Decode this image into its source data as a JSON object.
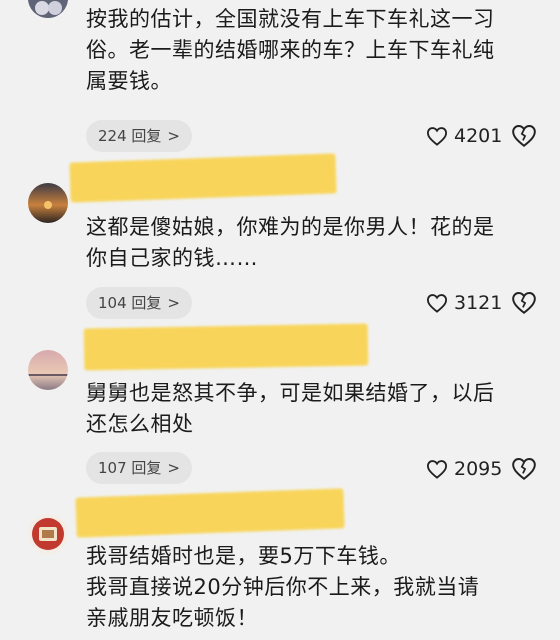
{
  "comments": [
    {
      "text_lines": [
        "按我的估计，全国就没有上车下车礼这一习",
        "俗。老一辈的结婚哪来的车？上车下车礼纯",
        "属要钱。"
      ],
      "reply_label": "224 回复",
      "likes": "4201",
      "avatar_color": "#6a6f82"
    },
    {
      "text_lines": [
        "这都是傻姑娘，你难为的是你男人！花的是",
        "你自己家的钱……"
      ],
      "reply_label": "104 回复",
      "likes": "3121",
      "avatar_color": "#c77a3a"
    },
    {
      "text_lines": [
        "舅舅也是怒其不争，可是如果结婚了，以后",
        "还怎么相处"
      ],
      "reply_label": "107 回复",
      "likes": "2095",
      "avatar_color": "#b98b8f"
    },
    {
      "text_lines": [
        "我哥结婚时也是，要5万下车钱。",
        "我哥直接说20分钟后你不上来，我就当请",
        "亲戚朋友吃顿饭！"
      ],
      "reply_label": "",
      "likes": "",
      "avatar_color": "#c23a2f"
    }
  ],
  "icons": {
    "like": "heart-outline-icon",
    "dislike": "broken-heart-icon",
    "reply_chevron": "chevron-right-icon"
  },
  "colors": {
    "background": "#f1f1f1",
    "pill": "#e4e4e4",
    "redaction": "#f8d55a"
  }
}
